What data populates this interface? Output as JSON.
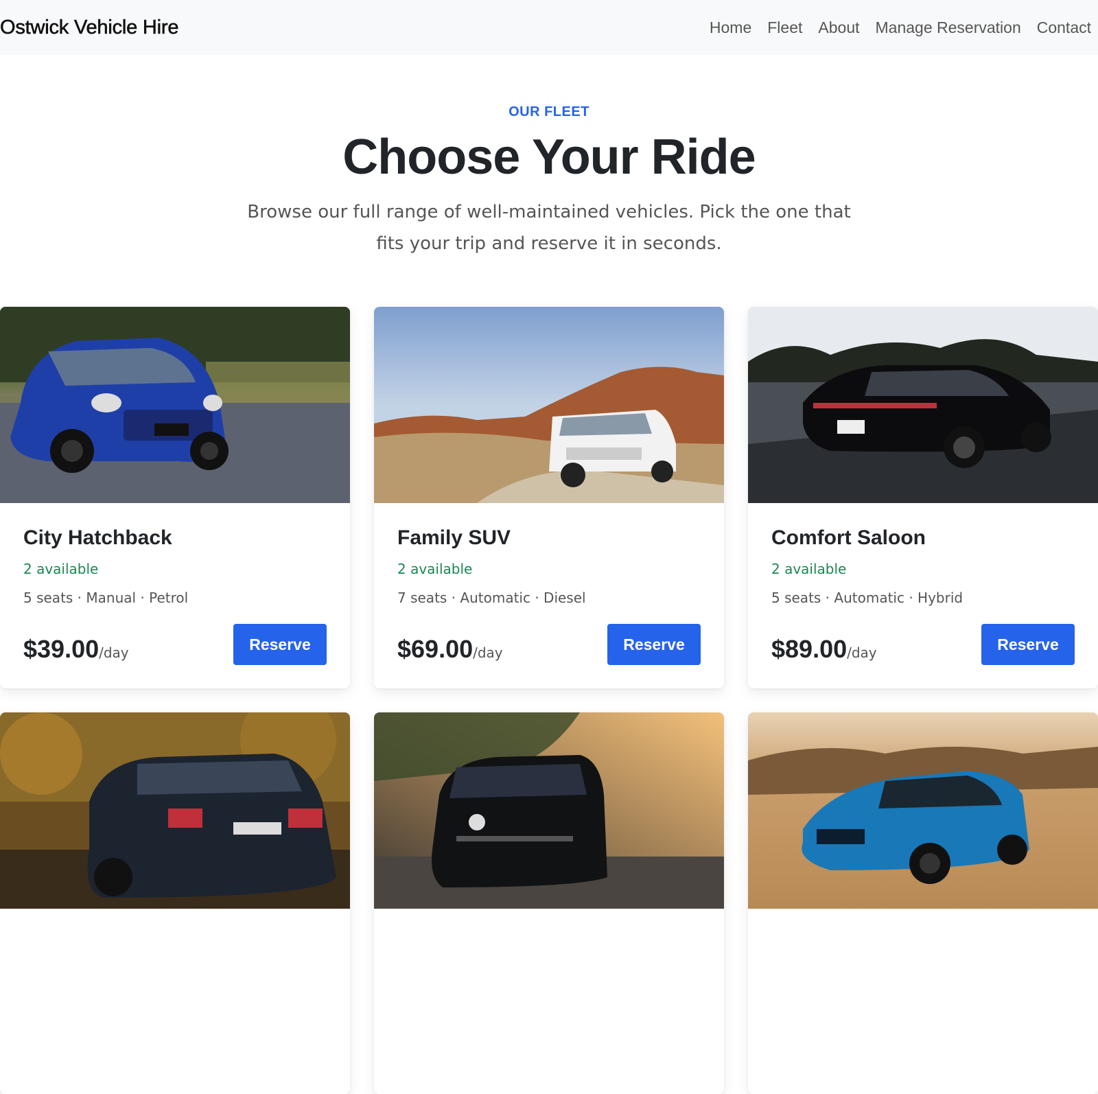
{
  "navbar": {
    "brand": "Ostwick Vehicle Hire",
    "links": [
      "Home",
      "Fleet",
      "About",
      "Manage Reservation",
      "Contact"
    ]
  },
  "hero": {
    "eyebrow": "OUR FLEET",
    "title": "Choose Your Ride",
    "subtitle": "Browse our full range of well-maintained vehicles. Pick the one that fits your trip and reserve it in seconds."
  },
  "cards": [
    {
      "title": "City Hatchback",
      "availability": "2 available",
      "specs": "5 seats · Manual · Petrol",
      "price": "$39.00",
      "per": "/day",
      "button": "Reserve",
      "image": "blue-hatchback-photo"
    },
    {
      "title": "Family SUV",
      "availability": "2 available",
      "specs": "7 seats · Automatic · Diesel",
      "price": "$69.00",
      "per": "/day",
      "button": "Reserve",
      "image": "white-suv-desert-photo"
    },
    {
      "title": "Comfort Saloon",
      "availability": "2 available",
      "specs": "5 seats · Automatic · Hybrid",
      "price": "$89.00",
      "per": "/day",
      "button": "Reserve",
      "image": "black-saloon-road-photo"
    },
    {
      "image": "dark-estate-autumn-photo"
    },
    {
      "image": "black-van-sunset-photo"
    },
    {
      "image": "blue-coupe-desert-photo"
    }
  ],
  "colors": {
    "accent": "#2563eb",
    "available": "#198754",
    "nav_bg": "#f8f9fa"
  }
}
